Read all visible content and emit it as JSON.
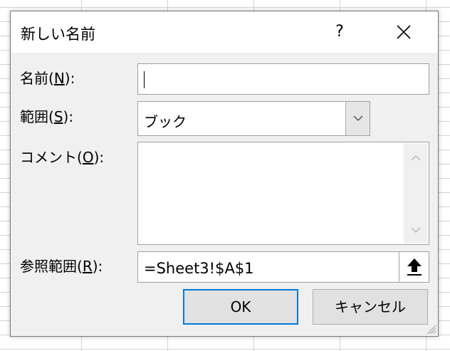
{
  "dialog": {
    "title": "新しい名前",
    "help_label": "?",
    "close_icon": "close-icon"
  },
  "fields": {
    "name": {
      "label_prefix": "名前(",
      "accel": "N",
      "label_suffix": "):",
      "value": ""
    },
    "scope": {
      "label_prefix": "範囲(",
      "accel": "S",
      "label_suffix": "):",
      "value": "ブック"
    },
    "comment": {
      "label_prefix": "コメント(",
      "accel": "O",
      "label_suffix": "):",
      "value": ""
    },
    "refers_to": {
      "label_prefix": "参照範囲(",
      "accel": "R",
      "label_suffix": "):",
      "value": "=Sheet3!$A$1"
    }
  },
  "buttons": {
    "ok": "OK",
    "cancel": "キャンセル"
  },
  "colors": {
    "dialog_bg": "#f0f0f0",
    "default_button_border": "#0078d7",
    "button_bg": "#e1e1e1"
  }
}
